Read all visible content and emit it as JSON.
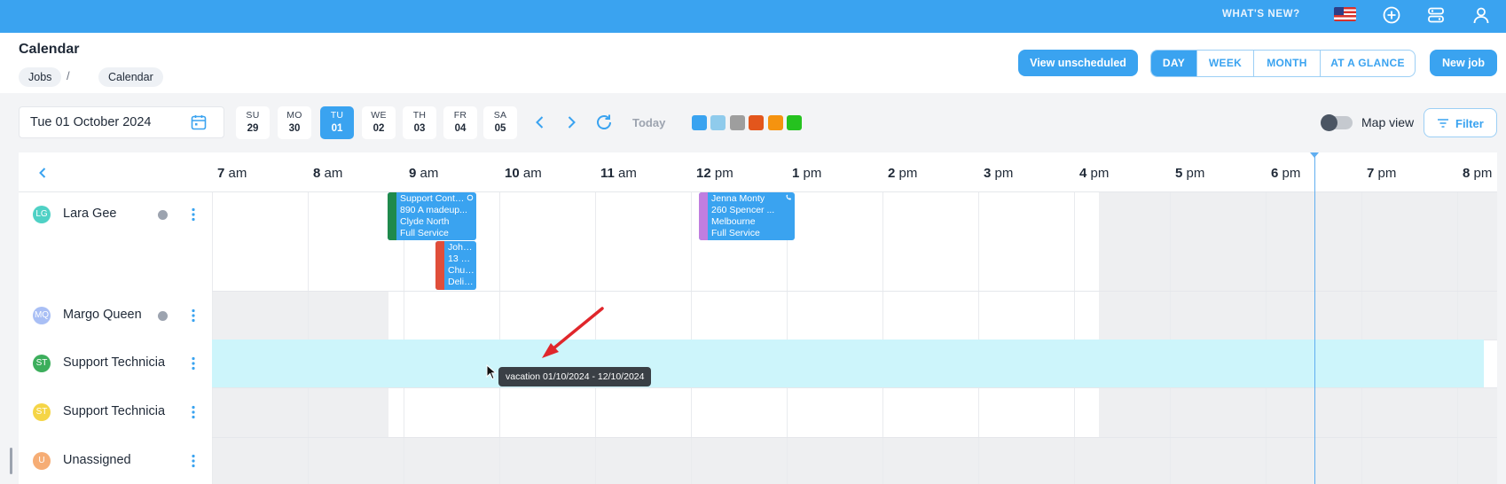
{
  "topbar": {
    "whats_new": "WHAT'S NEW?",
    "flag_icon": "us-flag-icon",
    "icons": [
      "plus-circle-icon",
      "settings-panel-icon",
      "user-icon"
    ]
  },
  "header": {
    "title": "Calendar",
    "breadcrumb": [
      "Jobs",
      "Calendar"
    ],
    "breadcrumb_separator": "/",
    "view_unscheduled": "View unscheduled",
    "views": [
      "DAY",
      "WEEK",
      "MONTH",
      "AT A GLANCE"
    ],
    "active_view": "DAY",
    "new_job": "New job"
  },
  "toolbar": {
    "date_value": "Tue 01 October 2024",
    "days": [
      {
        "name": "SU",
        "date": "29"
      },
      {
        "name": "MO",
        "date": "30"
      },
      {
        "name": "TU",
        "date": "01",
        "active": true
      },
      {
        "name": "WE",
        "date": "02"
      },
      {
        "name": "TH",
        "date": "03"
      },
      {
        "name": "FR",
        "date": "04"
      },
      {
        "name": "SA",
        "date": "05"
      }
    ],
    "today": "Today",
    "swatches": [
      "#3aa3f0",
      "#8fcbec",
      "#9e9e9e",
      "#e3561c",
      "#f5930f",
      "#25c21f"
    ],
    "map_view": "Map view",
    "filter": "Filter"
  },
  "calendar": {
    "hours": [
      {
        "num": "7",
        "unit": "am"
      },
      {
        "num": "8",
        "unit": "am"
      },
      {
        "num": "9",
        "unit": "am"
      },
      {
        "num": "10",
        "unit": "am"
      },
      {
        "num": "11",
        "unit": "am"
      },
      {
        "num": "12",
        "unit": "pm"
      },
      {
        "num": "1",
        "unit": "pm"
      },
      {
        "num": "2",
        "unit": "pm"
      },
      {
        "num": "3",
        "unit": "pm"
      },
      {
        "num": "4",
        "unit": "pm"
      },
      {
        "num": "5",
        "unit": "pm"
      },
      {
        "num": "6",
        "unit": "pm"
      },
      {
        "num": "7",
        "unit": "pm"
      },
      {
        "num": "8",
        "unit": "pm"
      }
    ],
    "resources": [
      {
        "initials": "LG",
        "name": "Lara Gee",
        "color": "#4fd1c5",
        "status": true
      },
      {
        "initials": "MQ",
        "name": "Margo Queen",
        "color": "#a9bff5",
        "status": true
      },
      {
        "initials": "ST",
        "name": "Support Technicia",
        "color": "#3cae5c",
        "status": false
      },
      {
        "initials": "ST",
        "name": "Support Technicia",
        "color": "#f5d547",
        "status": false
      },
      {
        "initials": "U",
        "name": "Unassigned",
        "color": "#f6ad75",
        "status": false
      }
    ],
    "jobs": [
      {
        "lines": [
          "Support Conta...",
          "890 A madeup...",
          "Clyde North",
          "Full Service"
        ],
        "bar_color": "#1f8a4c"
      },
      {
        "lines": [
          "John...",
          "13 B...",
          "Chur...",
          "Deliv..."
        ],
        "bar_color": "#e04e3a"
      },
      {
        "lines": [
          "Jenna Monty",
          "260 Spencer ...",
          "Melbourne",
          "Full Service"
        ],
        "bar_color": "#c07ee0"
      }
    ],
    "vacation_tooltip": "vacation 01/10/2024 - 12/10/2024"
  }
}
